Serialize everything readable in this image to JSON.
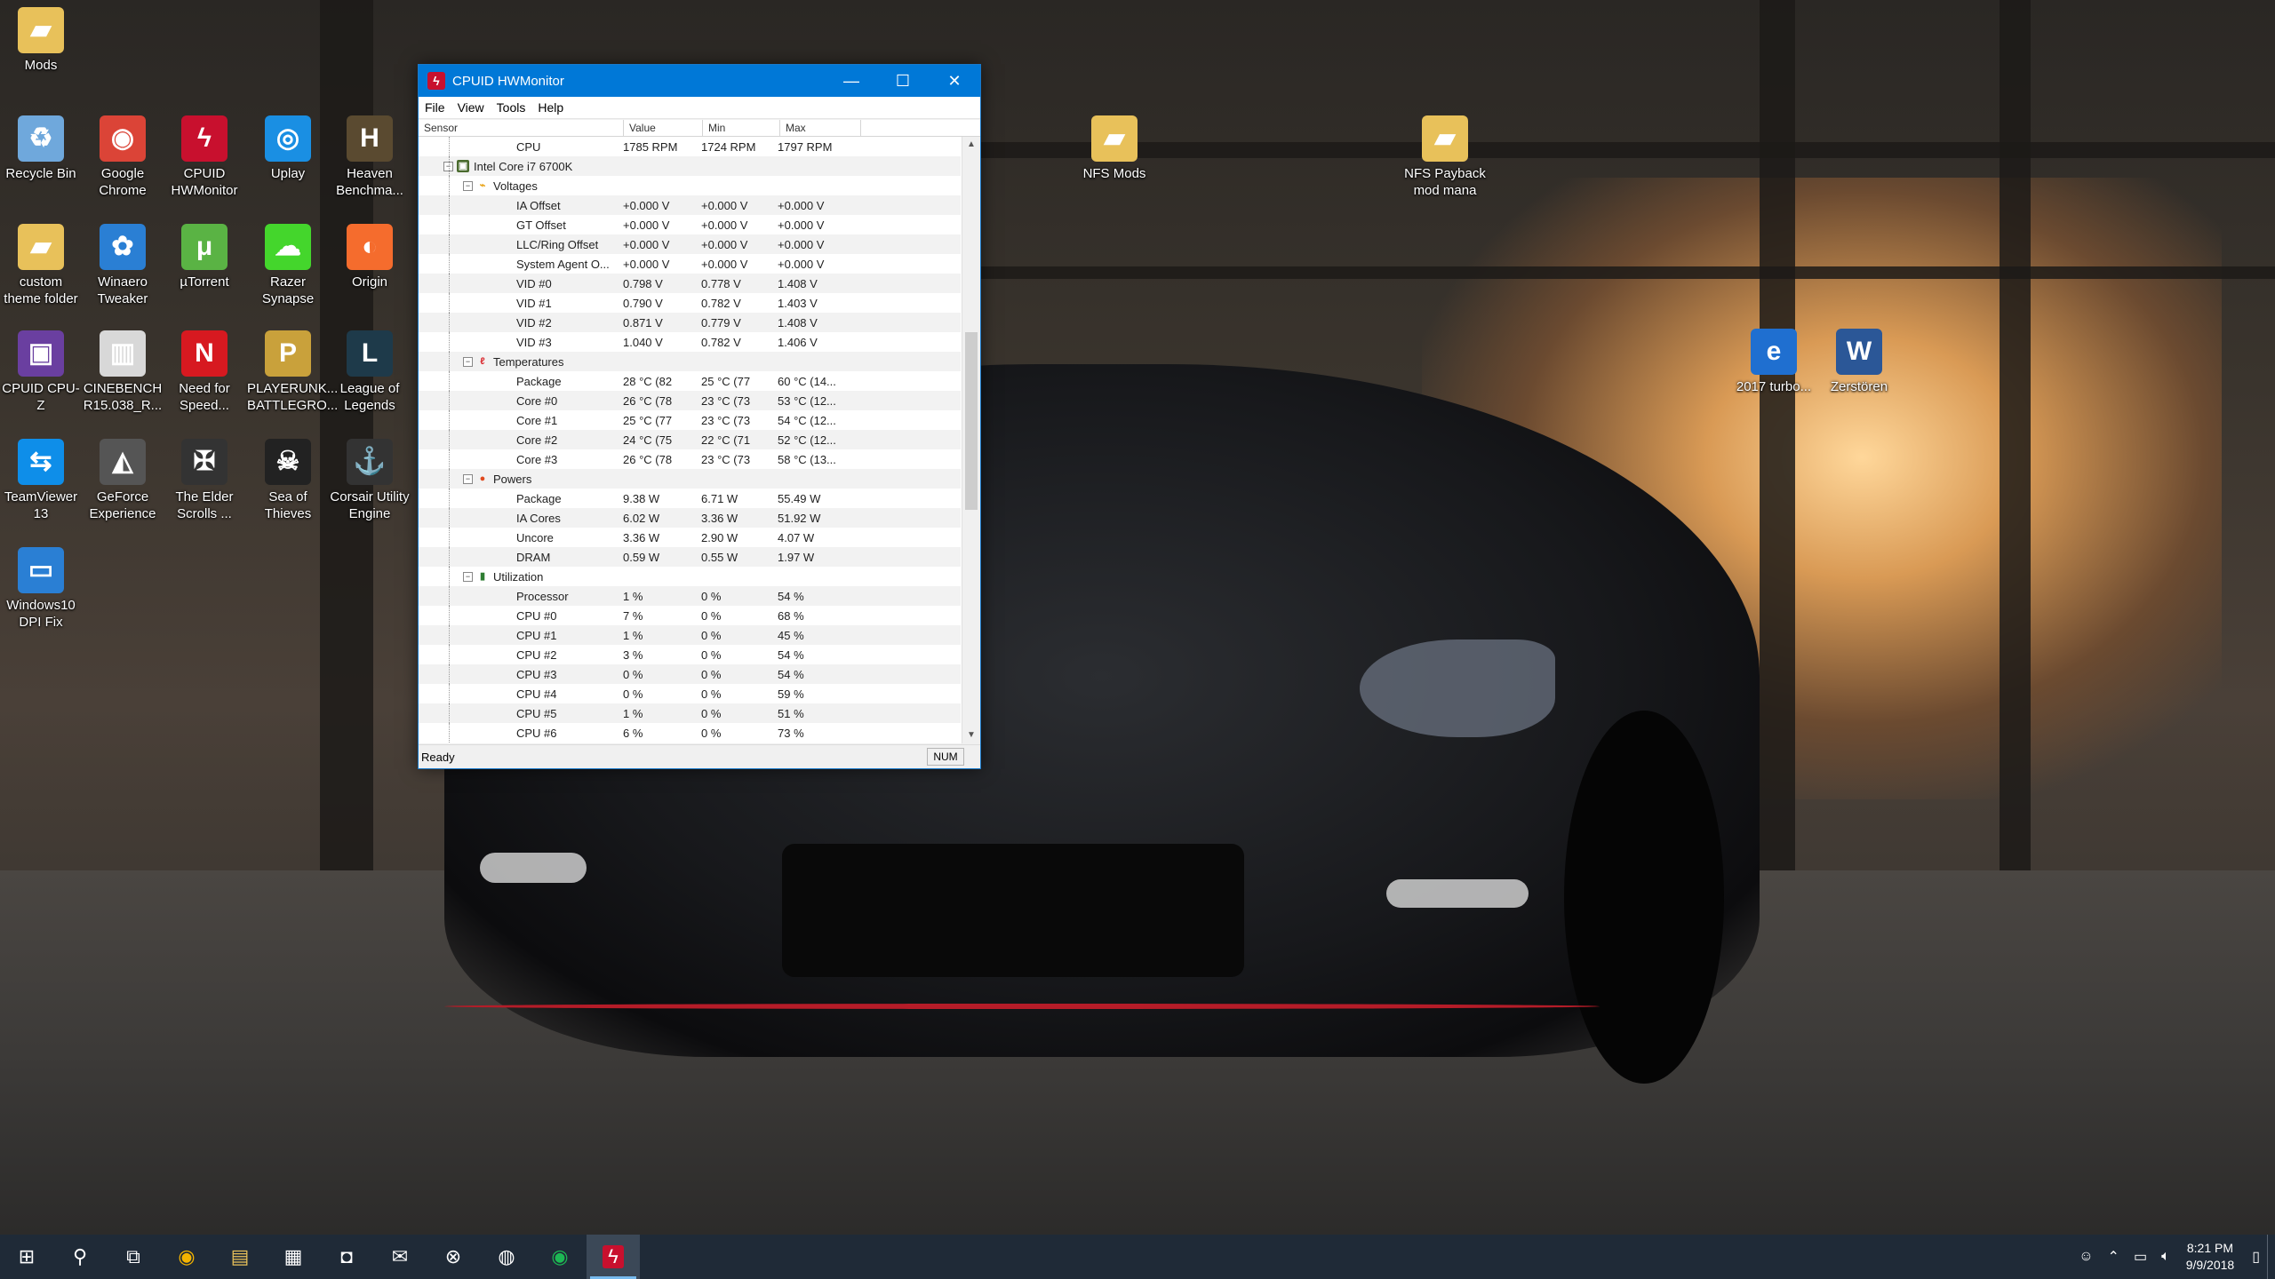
{
  "desktop_icons": [
    {
      "label": "Mods",
      "icon": "folder-icon",
      "color": "#e8c15a"
    },
    {
      "label": "Recycle Bin",
      "icon": "recycle-bin-icon",
      "color": "#6fa8dc"
    },
    {
      "label": "Google Chrome",
      "icon": "chrome-icon",
      "color": "#db4437"
    },
    {
      "label": "CPUID HWMonitor",
      "icon": "hwmonitor-icon",
      "color": "#c8102e"
    },
    {
      "label": "Uplay",
      "icon": "uplay-icon",
      "color": "#1a8fe3"
    },
    {
      "label": "Heaven Benchma...",
      "icon": "heaven-icon",
      "color": "#5a4a30"
    },
    {
      "label": "custom theme folder",
      "icon": "folder-icon",
      "color": "#e8c15a"
    },
    {
      "label": "Winaero Tweaker",
      "icon": "winaero-icon",
      "color": "#2a7fd4"
    },
    {
      "label": "µTorrent",
      "icon": "utorrent-icon",
      "color": "#5ab344"
    },
    {
      "label": "Razer Synapse",
      "icon": "razer-icon",
      "color": "#44d62c"
    },
    {
      "label": "Origin",
      "icon": "origin-icon",
      "color": "#f56c2d"
    },
    {
      "label": "CPUID CPU-Z",
      "icon": "cpuz-icon",
      "color": "#6a3fa0"
    },
    {
      "label": "CINEBENCH R15.038_R...",
      "icon": "cinebench-icon",
      "color": "#d8d8d8"
    },
    {
      "label": "Need for Speed...",
      "icon": "nfs-icon",
      "color": "#d71920"
    },
    {
      "label": "PLAYERUNK... BATTLEGRO...",
      "icon": "pubg-icon",
      "color": "#c9a13b"
    },
    {
      "label": "League of Legends",
      "icon": "lol-icon",
      "color": "#1e3a4a"
    },
    {
      "label": "TeamViewer 13",
      "icon": "teamviewer-icon",
      "color": "#0e8ee9"
    },
    {
      "label": "GeForce Experience",
      "icon": "geforce-icon",
      "color": "#555555"
    },
    {
      "label": "The Elder Scrolls ...",
      "icon": "elder-scrolls-icon",
      "color": "#333333"
    },
    {
      "label": "Sea of Thieves",
      "icon": "sea-of-thieves-icon",
      "color": "#222222"
    },
    {
      "label": "Corsair Utility Engine",
      "icon": "corsair-icon",
      "color": "#333333"
    },
    {
      "label": "Windows10 DPI Fix",
      "icon": "monitor-icon",
      "color": "#2a7fd4"
    },
    {
      "label": "NFS Mods",
      "icon": "folder-icon",
      "color": "#e8c15a"
    },
    {
      "label": "NFS Payback mod mana",
      "icon": "folder-icon",
      "color": "#e8c15a"
    },
    {
      "label": "2017 turbo...",
      "icon": "pdf-icon",
      "color": "#1f6fd0"
    },
    {
      "label": "Zerstören",
      "icon": "word-icon",
      "color": "#2b5797"
    }
  ],
  "window": {
    "title": "CPUID HWMonitor",
    "controls": {
      "minimize": "—",
      "maximize": "☐",
      "close": "✕"
    },
    "menu": [
      "File",
      "View",
      "Tools",
      "Help"
    ],
    "columns": [
      "Sensor",
      "Value",
      "Min",
      "Max"
    ],
    "status": "Ready",
    "num_indicator": "NUM",
    "rows": [
      {
        "level": 3,
        "type": "item",
        "sensor": "CPU",
        "value": "1785 RPM",
        "min": "1724 RPM",
        "max": "1797 RPM"
      },
      {
        "level": 1,
        "type": "device",
        "sensor": "Intel Core i7 6700K",
        "value": "",
        "min": "",
        "max": ""
      },
      {
        "level": 2,
        "type": "category",
        "icon": "voltage-icon",
        "sensor": "Voltages",
        "value": "",
        "min": "",
        "max": ""
      },
      {
        "level": 3,
        "type": "item",
        "sensor": "IA Offset",
        "value": "+0.000 V",
        "min": "+0.000 V",
        "max": "+0.000 V"
      },
      {
        "level": 3,
        "type": "item",
        "sensor": "GT Offset",
        "value": "+0.000 V",
        "min": "+0.000 V",
        "max": "+0.000 V"
      },
      {
        "level": 3,
        "type": "item",
        "sensor": "LLC/Ring Offset",
        "value": "+0.000 V",
        "min": "+0.000 V",
        "max": "+0.000 V"
      },
      {
        "level": 3,
        "type": "item",
        "sensor": "System Agent O...",
        "value": "+0.000 V",
        "min": "+0.000 V",
        "max": "+0.000 V"
      },
      {
        "level": 3,
        "type": "item",
        "sensor": "VID #0",
        "value": "0.798 V",
        "min": "0.778 V",
        "max": "1.408 V"
      },
      {
        "level": 3,
        "type": "item",
        "sensor": "VID #1",
        "value": "0.790 V",
        "min": "0.782 V",
        "max": "1.403 V"
      },
      {
        "level": 3,
        "type": "item",
        "sensor": "VID #2",
        "value": "0.871 V",
        "min": "0.779 V",
        "max": "1.408 V"
      },
      {
        "level": 3,
        "type": "item",
        "sensor": "VID #3",
        "value": "1.040 V",
        "min": "0.782 V",
        "max": "1.406 V"
      },
      {
        "level": 2,
        "type": "category",
        "icon": "thermometer-icon",
        "sensor": "Temperatures",
        "value": "",
        "min": "",
        "max": ""
      },
      {
        "level": 3,
        "type": "item",
        "sensor": "Package",
        "value": "28 °C (82",
        "min": "25 °C (77",
        "max": "60 °C (14..."
      },
      {
        "level": 3,
        "type": "item",
        "sensor": "Core #0",
        "value": "26 °C (78",
        "min": "23 °C (73",
        "max": "53 °C (12..."
      },
      {
        "level": 3,
        "type": "item",
        "sensor": "Core #1",
        "value": "25 °C (77",
        "min": "23 °C (73",
        "max": "54 °C (12..."
      },
      {
        "level": 3,
        "type": "item",
        "sensor": "Core #2",
        "value": "24 °C (75",
        "min": "22 °C (71",
        "max": "52 °C (12..."
      },
      {
        "level": 3,
        "type": "item",
        "sensor": "Core #3",
        "value": "26 °C (78",
        "min": "23 °C (73",
        "max": "58 °C (13..."
      },
      {
        "level": 2,
        "type": "category",
        "icon": "power-icon",
        "sensor": "Powers",
        "value": "",
        "min": "",
        "max": ""
      },
      {
        "level": 3,
        "type": "item",
        "sensor": "Package",
        "value": "9.38 W",
        "min": "6.71 W",
        "max": "55.49 W"
      },
      {
        "level": 3,
        "type": "item",
        "sensor": "IA Cores",
        "value": "6.02 W",
        "min": "3.36 W",
        "max": "51.92 W"
      },
      {
        "level": 3,
        "type": "item",
        "sensor": "Uncore",
        "value": "3.36 W",
        "min": "2.90 W",
        "max": "4.07 W"
      },
      {
        "level": 3,
        "type": "item",
        "sensor": "DRAM",
        "value": "0.59 W",
        "min": "0.55 W",
        "max": "1.97 W"
      },
      {
        "level": 2,
        "type": "category",
        "icon": "utilization-icon",
        "sensor": "Utilization",
        "value": "",
        "min": "",
        "max": ""
      },
      {
        "level": 3,
        "type": "item",
        "sensor": "Processor",
        "value": "1 %",
        "min": "0 %",
        "max": "54 %"
      },
      {
        "level": 3,
        "type": "item",
        "sensor": "CPU #0",
        "value": "7 %",
        "min": "0 %",
        "max": "68 %"
      },
      {
        "level": 3,
        "type": "item",
        "sensor": "CPU #1",
        "value": "1 %",
        "min": "0 %",
        "max": "45 %"
      },
      {
        "level": 3,
        "type": "item",
        "sensor": "CPU #2",
        "value": "3 %",
        "min": "0 %",
        "max": "54 %"
      },
      {
        "level": 3,
        "type": "item",
        "sensor": "CPU #3",
        "value": "0 %",
        "min": "0 %",
        "max": "54 %"
      },
      {
        "level": 3,
        "type": "item",
        "sensor": "CPU #4",
        "value": "0 %",
        "min": "0 %",
        "max": "59 %"
      },
      {
        "level": 3,
        "type": "item",
        "sensor": "CPU #5",
        "value": "1 %",
        "min": "0 %",
        "max": "51 %"
      },
      {
        "level": 3,
        "type": "item",
        "sensor": "CPU #6",
        "value": "6 %",
        "min": "0 %",
        "max": "73 %"
      }
    ]
  },
  "taskbar": {
    "items": [
      {
        "name": "start-button",
        "icon": "windows-logo-icon",
        "glyph": "⊞"
      },
      {
        "name": "search-button",
        "icon": "search-icon",
        "glyph": "⚲"
      },
      {
        "name": "task-view-button",
        "icon": "task-view-icon",
        "glyph": "⧉"
      },
      {
        "name": "taskbar-chrome",
        "icon": "chrome-icon",
        "glyph": "◉"
      },
      {
        "name": "taskbar-file-explorer",
        "icon": "folder-icon",
        "glyph": "▤"
      },
      {
        "name": "taskbar-calculator",
        "icon": "calculator-icon",
        "glyph": "▦"
      },
      {
        "name": "taskbar-store",
        "icon": "store-icon",
        "glyph": "◘"
      },
      {
        "name": "taskbar-mail",
        "icon": "mail-icon",
        "glyph": "✉"
      },
      {
        "name": "taskbar-xbox",
        "icon": "xbox-icon",
        "glyph": "⊗"
      },
      {
        "name": "taskbar-messenger",
        "icon": "messenger-icon",
        "glyph": "◍"
      },
      {
        "name": "taskbar-spotify",
        "icon": "spotify-icon",
        "glyph": "◉"
      },
      {
        "name": "taskbar-hwmonitor",
        "icon": "hwmonitor-icon",
        "glyph": "ϟ"
      }
    ],
    "time": "8:21 PM",
    "date": "9/9/2018"
  }
}
